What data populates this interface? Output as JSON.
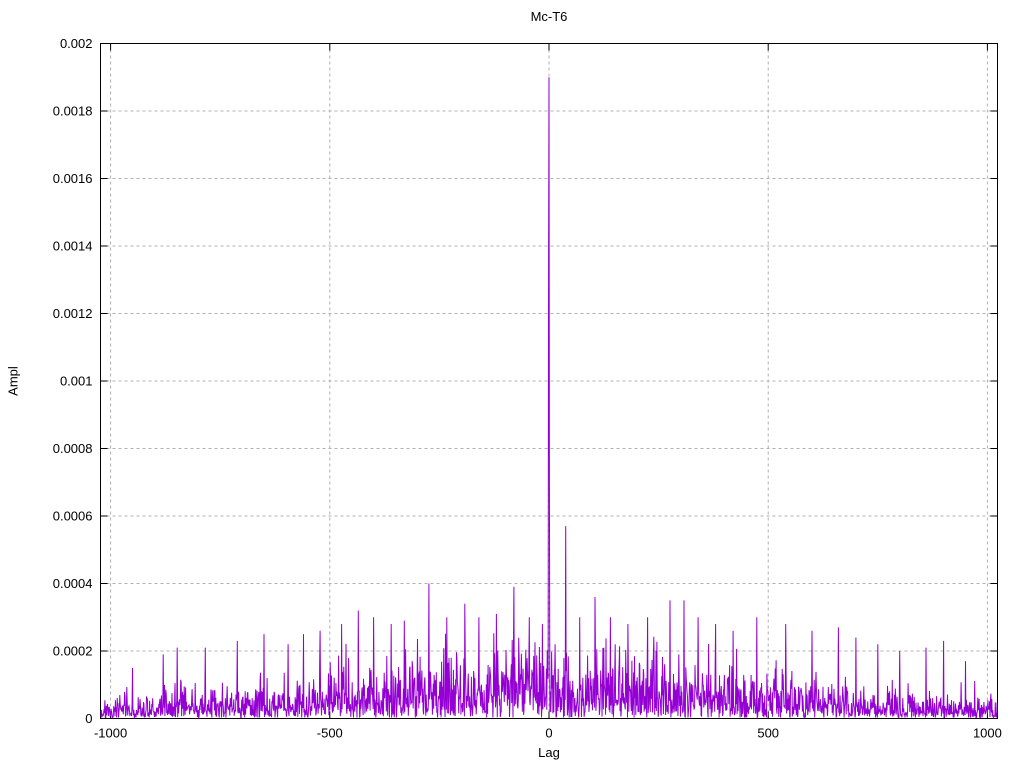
{
  "figure": {
    "background": "#ffffff"
  },
  "chart_data": {
    "type": "line",
    "title": "Mc-T6",
    "xlabel": "Lag",
    "ylabel": "Ampl",
    "xlim": [
      -1023,
      1023
    ],
    "ylim": [
      0,
      0.002
    ],
    "x_ticks": [
      -1000,
      -500,
      0,
      500,
      1000
    ],
    "x_tick_labels": [
      "-1000",
      "-500",
      "0",
      "500",
      "1000"
    ],
    "y_ticks": [
      0,
      0.0002,
      0.0004,
      0.0006,
      0.0008,
      0.001,
      0.0012,
      0.0014,
      0.0016,
      0.0018,
      0.002
    ],
    "y_tick_labels": [
      "0",
      "0.0002",
      "0.0004",
      "0.0006",
      "0.0008",
      "0.001",
      "0.0012",
      "0.0014",
      "0.0016",
      "0.0018",
      "0.002"
    ],
    "grid": true,
    "grid_style": "dashed",
    "legend_position": "none",
    "line_color": "#9400d3",
    "grid_color": "#b0b0b0",
    "border_color": "#000000",
    "series_name": "correlation amplitude vs lag",
    "main_peak": {
      "lag": 0,
      "value": 0.0019
    },
    "notable_points": [
      [
        -950,
        0.00015
      ],
      [
        -880,
        0.00019
      ],
      [
        -848,
        0.00021
      ],
      [
        -784,
        0.00021
      ],
      [
        -711,
        0.00023
      ],
      [
        -650,
        0.00025
      ],
      [
        -595,
        0.00022
      ],
      [
        -560,
        0.00025
      ],
      [
        -522,
        0.00026
      ],
      [
        -473,
        0.00028
      ],
      [
        -435,
        0.00032
      ],
      [
        -400,
        0.0003
      ],
      [
        -360,
        0.00028
      ],
      [
        -330,
        0.00029
      ],
      [
        -274,
        0.0004
      ],
      [
        -233,
        0.0003
      ],
      [
        -192,
        0.00034
      ],
      [
        -160,
        0.0003
      ],
      [
        -120,
        0.00031
      ],
      [
        -80,
        0.00039
      ],
      [
        -45,
        0.0003
      ],
      [
        -15,
        0.00028
      ],
      [
        -1,
        0.0014
      ],
      [
        0,
        0.0019
      ],
      [
        1,
        0.0007
      ],
      [
        14,
        0.00022
      ],
      [
        38,
        0.00057
      ],
      [
        70,
        0.0003
      ],
      [
        105,
        0.00036
      ],
      [
        140,
        0.0003
      ],
      [
        180,
        0.00028
      ],
      [
        225,
        0.0003
      ],
      [
        276,
        0.00035
      ],
      [
        308,
        0.00035
      ],
      [
        340,
        0.0003
      ],
      [
        380,
        0.00028
      ],
      [
        420,
        0.00026
      ],
      [
        474,
        0.0003
      ],
      [
        540,
        0.00028
      ],
      [
        600,
        0.00026
      ],
      [
        660,
        0.00027
      ],
      [
        700,
        0.00024
      ],
      [
        750,
        0.00022
      ],
      [
        800,
        0.0002
      ],
      [
        860,
        0.00021
      ],
      [
        900,
        0.00023
      ],
      [
        950,
        0.00017
      ]
    ],
    "noise_model": {
      "seed": 20240613,
      "distribution": "half-normal",
      "sigma_base": 3e-05,
      "sigma_peak": 8.5e-05,
      "shape_exponent": 1.4
    }
  }
}
